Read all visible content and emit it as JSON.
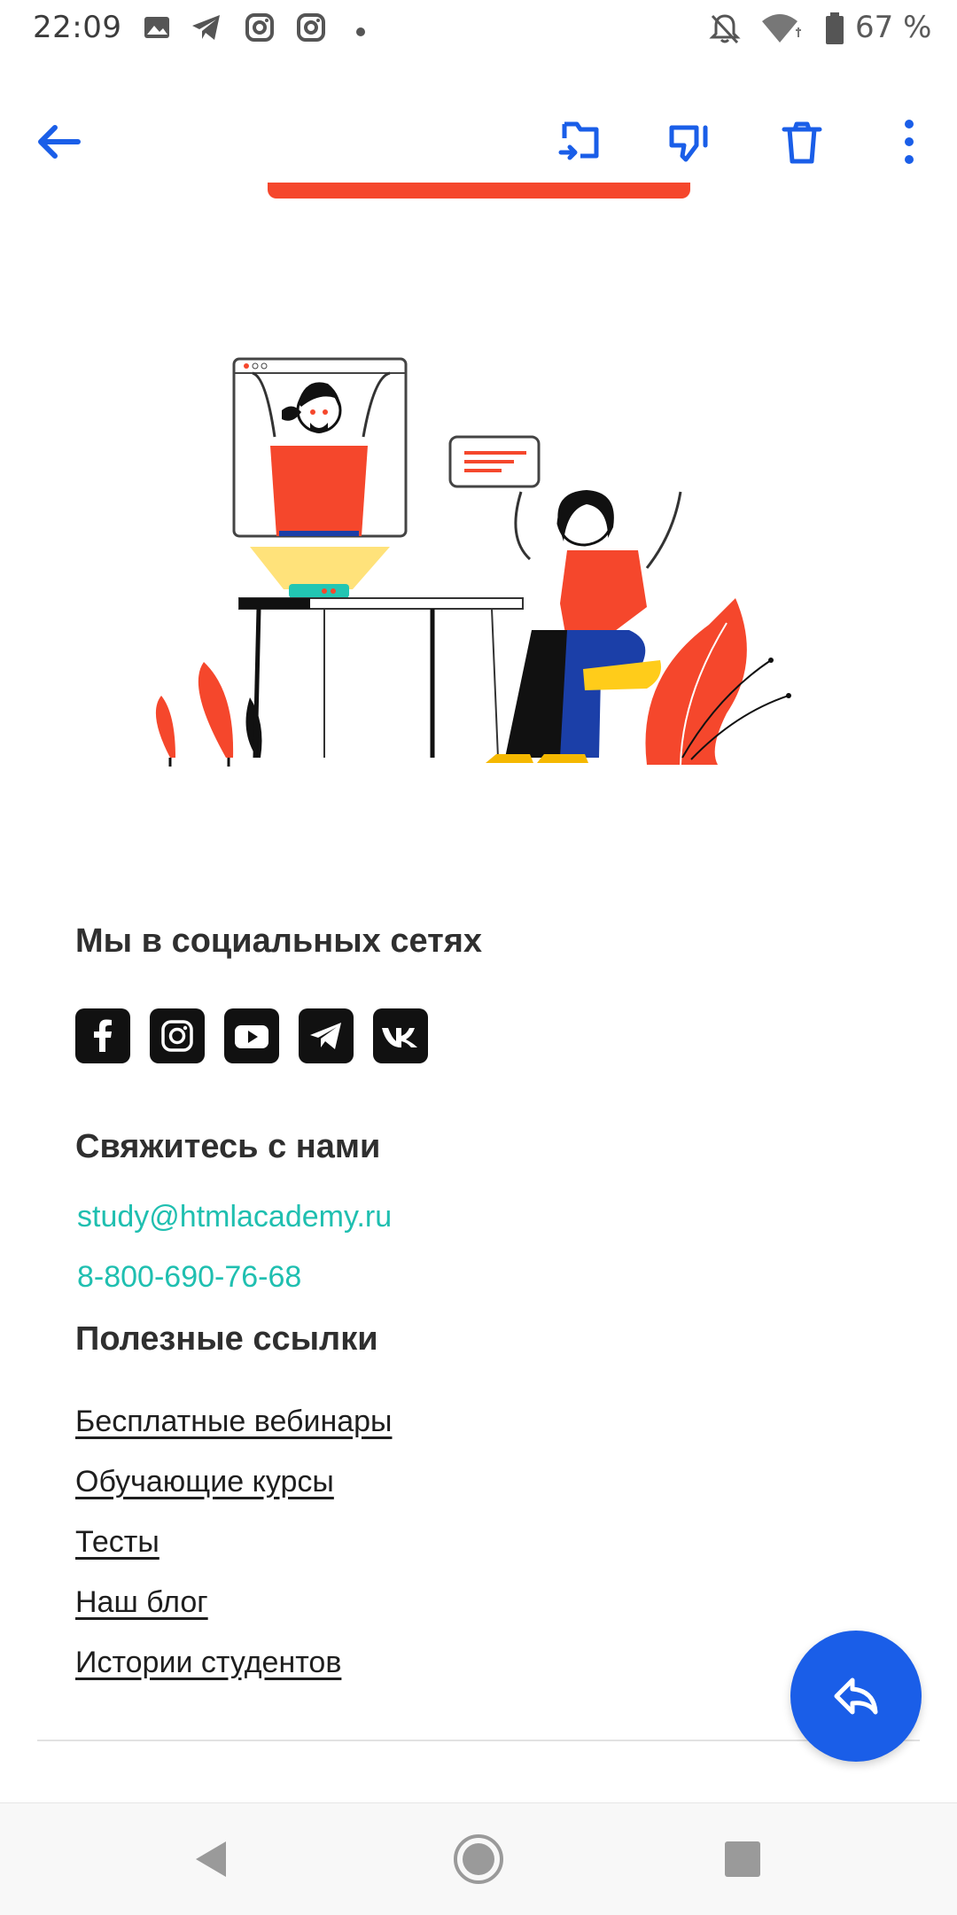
{
  "status_bar": {
    "time": "22:09",
    "battery": "67 %",
    "icons": [
      "gallery-icon",
      "telegram-icon",
      "instagram-icon",
      "instagram-icon",
      "dot-icon",
      "bell-off-icon",
      "wifi-icon",
      "battery-icon"
    ]
  },
  "toolbar": {
    "back_icon": "arrow-left-icon",
    "actions": [
      "move-to-folder-icon",
      "spam-icon",
      "trash-icon",
      "more-vertical-icon"
    ]
  },
  "footer": {
    "social_title": "Мы в социальных сетях",
    "social_icons": [
      "facebook-icon",
      "instagram-icon",
      "youtube-icon",
      "telegram-icon",
      "vk-icon"
    ],
    "contact_title": "Свяжитесь с нами",
    "email": "study@htmlacademy.ru",
    "phone": "8-800-690-76-68",
    "links_title": "Полезные ссылки",
    "links": [
      "Бесплатные вебинары",
      "Обучающие курсы",
      "Тесты",
      "Наш блог",
      "Истории студентов"
    ]
  },
  "colors": {
    "accent": "#1a5ee8",
    "brand_orange": "#f5472c",
    "link_teal": "#1fbfb0"
  }
}
